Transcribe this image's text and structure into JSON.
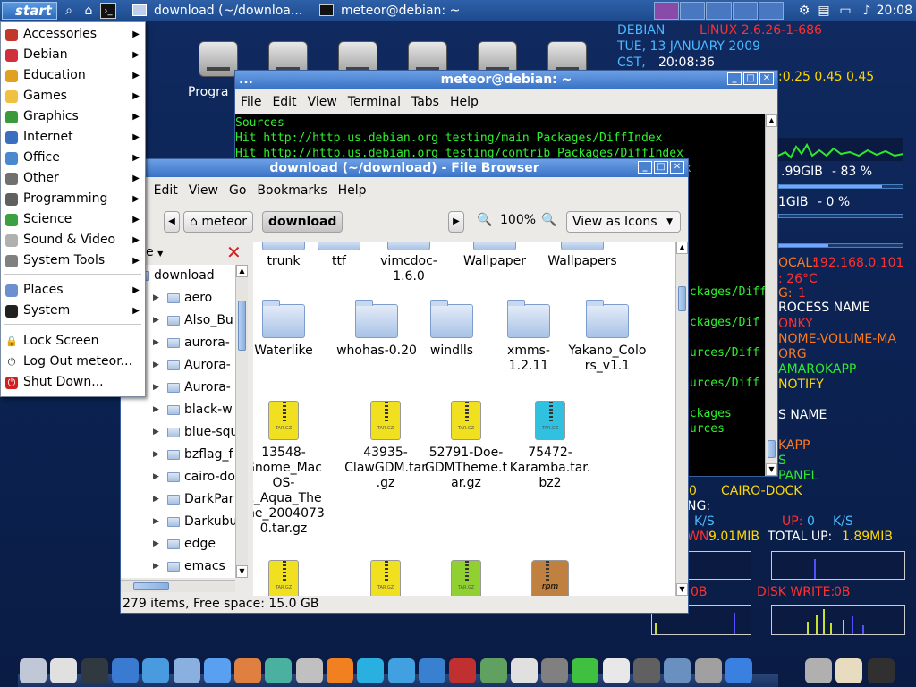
{
  "top_panel": {
    "start_label": "start",
    "tasks": [
      {
        "label": "download (~/downloa..."
      },
      {
        "label": "meteor@debian: ~"
      }
    ],
    "clock": "20:08"
  },
  "desktop": {
    "label_program": "Progra"
  },
  "app_menu": {
    "items": [
      {
        "label": "Accessories",
        "icon_color": "#c0392b"
      },
      {
        "label": "Debian",
        "icon_color": "#d0303a"
      },
      {
        "label": "Education",
        "icon_color": "#e0a020"
      },
      {
        "label": "Games",
        "icon_color": "#f0c040"
      },
      {
        "label": "Graphics",
        "icon_color": "#3a9a3a"
      },
      {
        "label": "Internet",
        "icon_color": "#3a6ec0"
      },
      {
        "label": "Office",
        "icon_color": "#4a88d0"
      },
      {
        "label": "Other",
        "icon_color": "#707070"
      },
      {
        "label": "Programming",
        "icon_color": "#606060"
      },
      {
        "label": "Science",
        "icon_color": "#3aa040"
      },
      {
        "label": "Sound & Video",
        "icon_color": "#b0b0b0"
      },
      {
        "label": "System Tools",
        "icon_color": "#808080"
      }
    ],
    "places": [
      {
        "label": "Places"
      },
      {
        "label": "System"
      }
    ],
    "session": [
      {
        "label": "Lock Screen"
      },
      {
        "label": "Log Out meteor..."
      },
      {
        "label": "Shut Down..."
      }
    ]
  },
  "terminal": {
    "title": "meteor@debian: ~",
    "dots": "...",
    "menu": [
      "File",
      "Edit",
      "View",
      "Terminal",
      "Tabs",
      "Help"
    ],
    "lines": [
      "Sources",
      "Hit http://http.us.debian.org testing/main Packages/DiffIndex",
      "Hit http://http.us.debian.org testing/contrib Packages/DiffIndex"
    ],
    "partial_lines": [
      "ex",
      "x",
      "ackages/Diff",
      "ackages/Dif",
      "ources/Diff",
      "ources/Diff",
      "ackages",
      "ources"
    ]
  },
  "file_browser": {
    "title": "download (~/download) - File Browser",
    "menu": [
      "e",
      "Edit",
      "View",
      "Go",
      "Bookmarks",
      "Help"
    ],
    "crumb_home": "meteor",
    "crumb_current": "download",
    "zoom": "100%",
    "view_mode": "View as Icons",
    "sidebar_mode": "e",
    "tree": [
      "download",
      "aero",
      "Also_Bu",
      "aurora-",
      "Aurora-",
      "Aurora-",
      "black-w",
      "blue-squ",
      "bzflag_f",
      "cairo-do",
      "DarkPar",
      "Darkubu",
      "edge",
      "emacs"
    ],
    "icons_row1": [
      "trunk",
      "ttf",
      "vimcdoc-1.6.0",
      "Wallpaper",
      "Wallpapers"
    ],
    "icons_row2": [
      "Waterlike",
      "whohas-0.20",
      "windlls",
      "xmms-1.2.11",
      "Yakano_Colors_v1.1"
    ],
    "icons_row3": [
      {
        "label": "13548-Gnome_MacOS-X_Aqua_Theme_20040730.tar.gz",
        "color": "#f0e020"
      },
      {
        "label": "43935-ClawGDM.tar.gz",
        "color": "#f0e020"
      },
      {
        "label": "52791-Doe-GDMTheme.tar.gz",
        "color": "#f0e020"
      },
      {
        "label": "75472-Karamba.tar.bz2",
        "color": "#30c0e0"
      }
    ],
    "icons_row4": [
      {
        "label": "",
        "color": "#f0e020"
      },
      {
        "label": "",
        "color": "#f0e020"
      },
      {
        "label": "",
        "color": "#90d030"
      },
      {
        "label": "rpm",
        "color": "#c08040"
      }
    ],
    "status": "279 items, Free space: 15.0 GB"
  },
  "conky": {
    "distro": "DEBIAN",
    "kernel": "LINUX 2.6.26-1-686",
    "date": "TUE, 13 JANUARY 2009",
    "tz": "CST,",
    "time": "20:08:36",
    "load": ":0.25 0.45 0.45",
    "mem": ".99GIB",
    "mem_pct": "- 83 %",
    "mem_level": 83,
    "swap": "1GIB",
    "swap_pct": "- 0  %",
    "swap_level": 0,
    "local_label": "OCAL:",
    "local_ip": "192.168.0.101",
    "temp": ": 26°C",
    "g_label": "G:",
    "g_value": "1",
    "process_header": "ROCESS NAME",
    "processes": [
      "ONKY",
      "NOME-VOLUME-MA",
      "ORG",
      "AMAROKAPP",
      "NOTIFY"
    ],
    "process2_header": "S NAME",
    "processes2": [
      "KAPP",
      "S",
      "PANEL"
    ],
    "cairo_num": "0",
    "cairo": "CAIRO-DOCK",
    "ng": "NG:",
    "ks": "K/S",
    "up_label": "UP:",
    "up_value": "0",
    "up_unit": "K/S",
    "dn_label": "WN:",
    "dn_value": "9.01MIB",
    "total_up_label": "TOTAL UP:",
    "total_up_value": "1.89MIB",
    "ob": "0B",
    "disk_write_label": "DISK WRITE:",
    "disk_write_value": "0B"
  }
}
